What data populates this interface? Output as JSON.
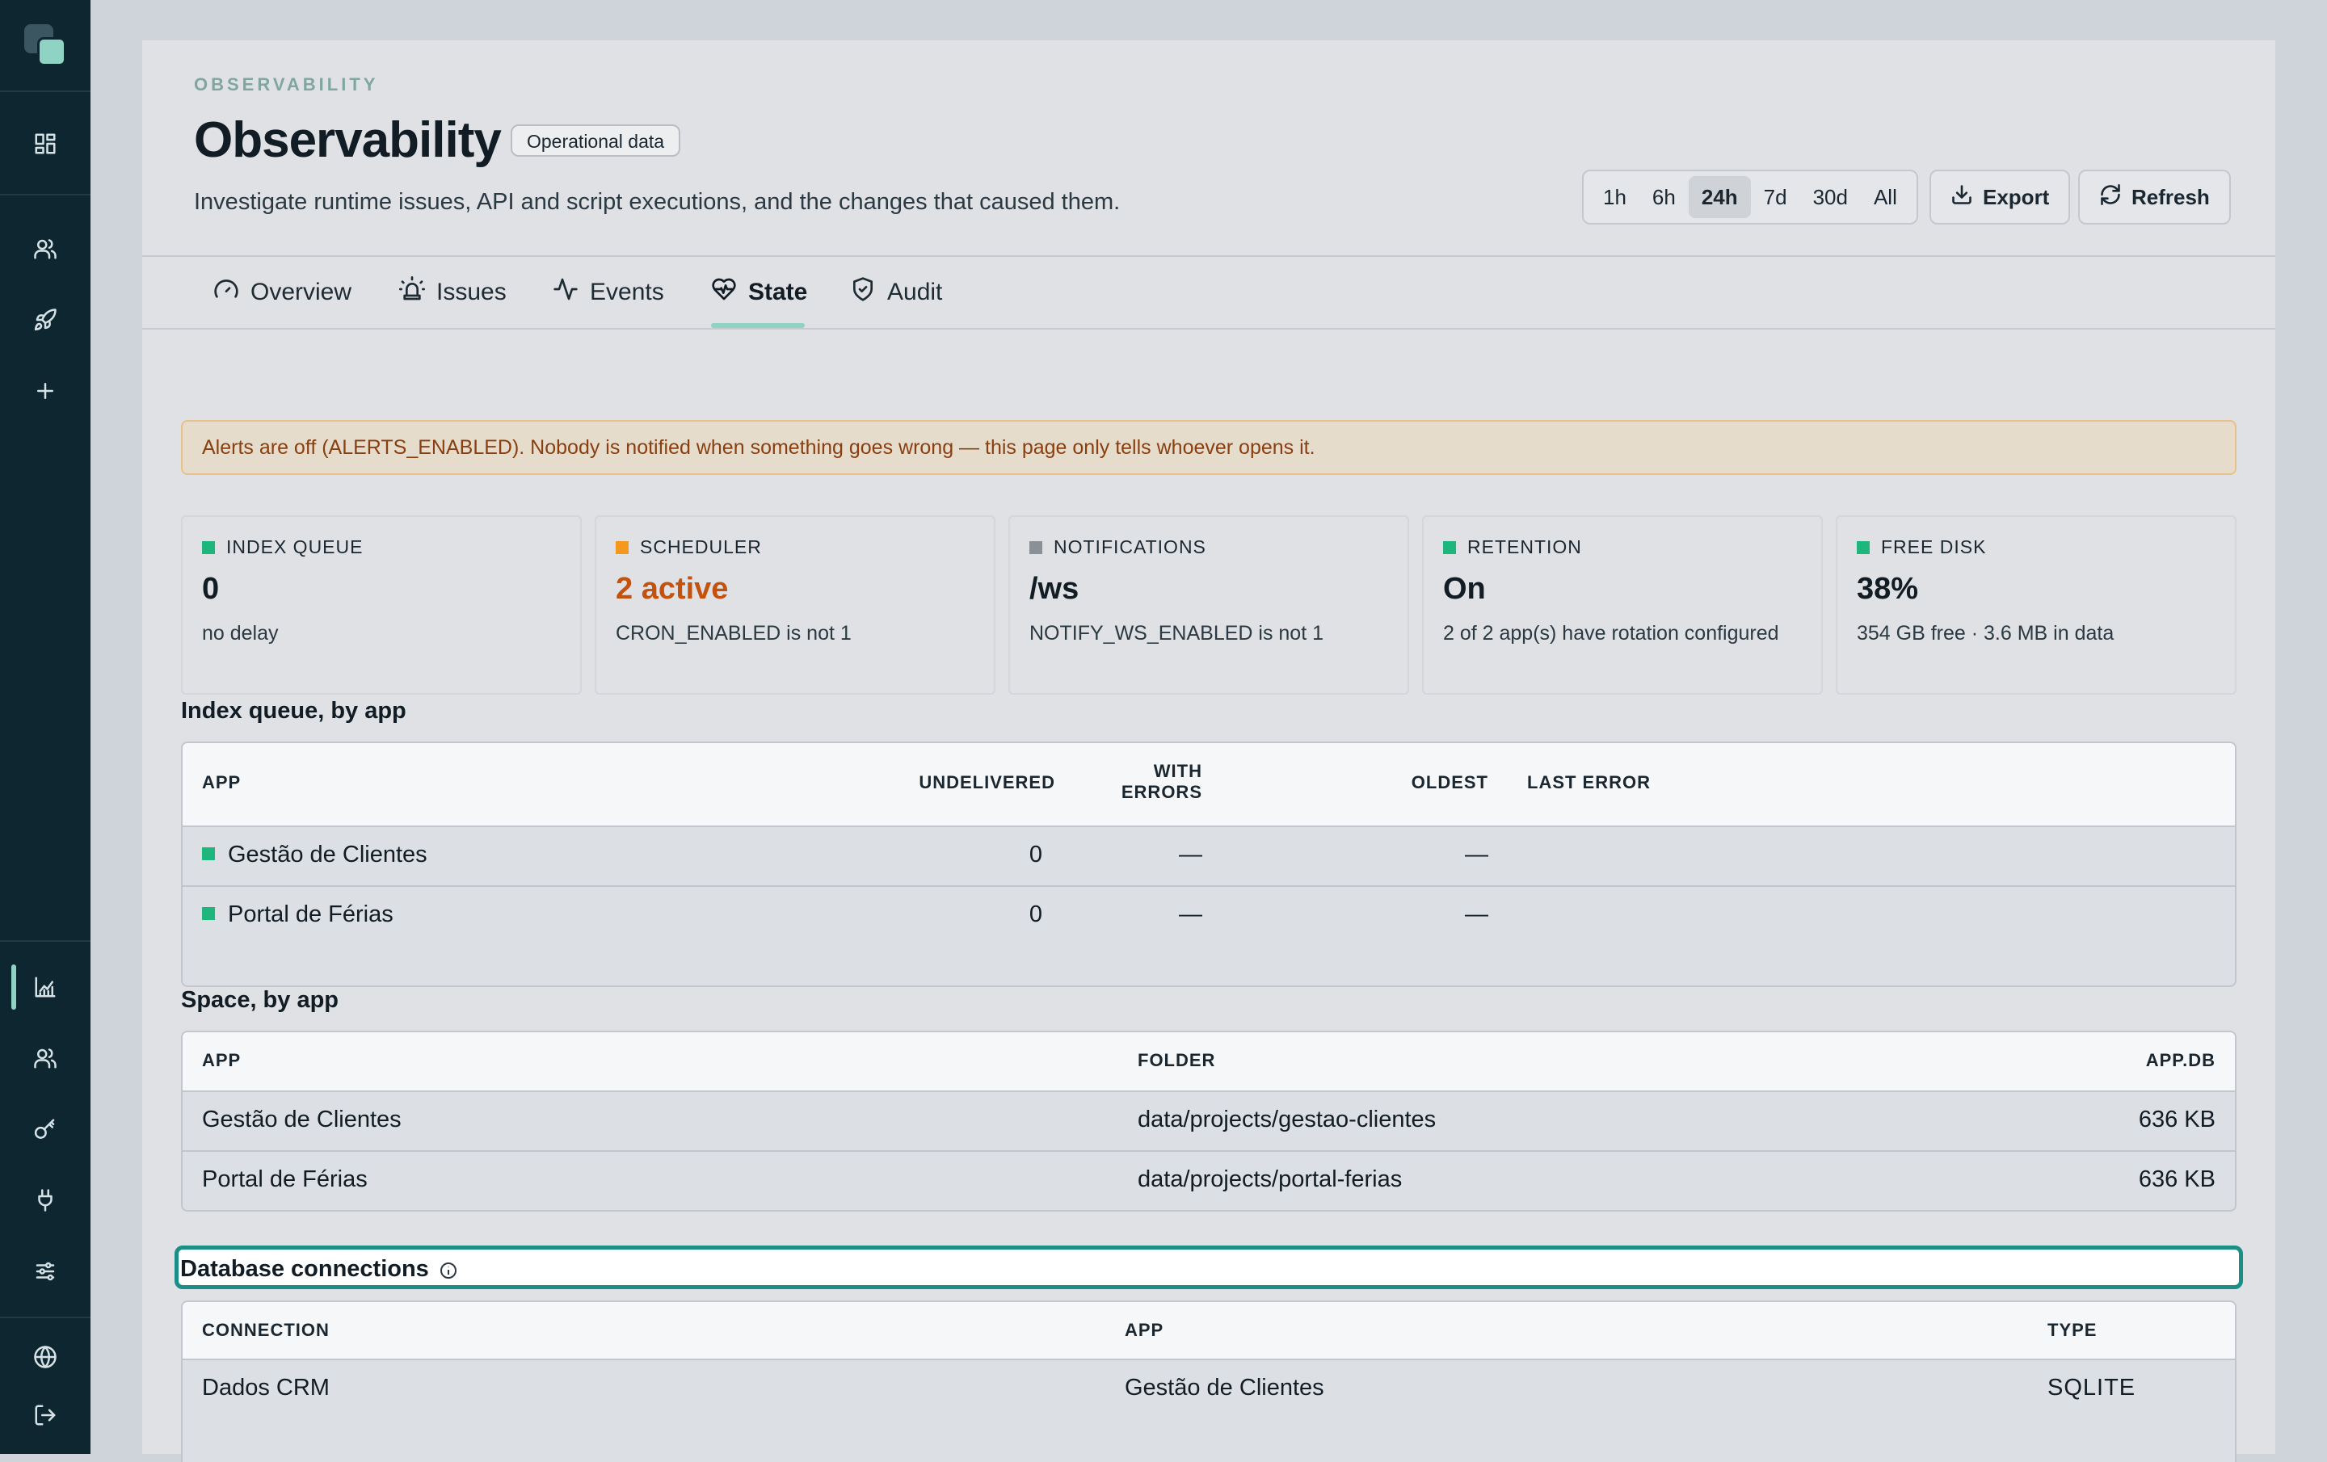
{
  "sidebar": {
    "icons": [
      "dashboard-icon",
      "users-icon",
      "rocket-icon",
      "plus-icon",
      "analytics-icon",
      "team-icon",
      "key-icon",
      "plug-icon",
      "sliders-icon",
      "globe-icon",
      "logout-icon"
    ],
    "active": "analytics-icon"
  },
  "header": {
    "eyebrow": "OBSERVABILITY",
    "title": "Observability",
    "badge": "Operational data",
    "subtitle": "Investigate runtime issues, API and script executions, and the changes that caused them."
  },
  "time_range": {
    "options": [
      "1h",
      "6h",
      "24h",
      "7d",
      "30d",
      "All"
    ],
    "selected": "24h"
  },
  "actions": {
    "export": "Export",
    "refresh": "Refresh"
  },
  "tabs": [
    {
      "label": "Overview",
      "icon": "gauge-icon"
    },
    {
      "label": "Issues",
      "icon": "siren-icon"
    },
    {
      "label": "Events",
      "icon": "activity-icon"
    },
    {
      "label": "State",
      "icon": "heart-pulse-icon"
    },
    {
      "label": "Audit",
      "icon": "shield-check-icon"
    }
  ],
  "active_tab": "State",
  "alert": "Alerts are off (ALERTS_ENABLED). Nobody is notified when something goes wrong — this page only tells whoever opens it.",
  "stats": [
    {
      "label": "INDEX QUEUE",
      "value": "0",
      "sub": "no delay",
      "color": "#1fb67d",
      "value_color": "#111c24"
    },
    {
      "label": "SCHEDULER",
      "value": "2 active",
      "sub": "CRON_ENABLED is not 1",
      "color": "#f39a1e",
      "value_color": "#c4520d"
    },
    {
      "label": "NOTIFICATIONS",
      "value": "/ws",
      "sub": "NOTIFY_WS_ENABLED is not 1",
      "color": "#8a9097",
      "value_color": "#111c24"
    },
    {
      "label": "RETENTION",
      "value": "On",
      "sub": "2 of 2 app(s) have rotation configured",
      "color": "#1fb67d",
      "value_color": "#111c24"
    },
    {
      "label": "FREE DISK",
      "value": "38%",
      "sub": "354 GB free · 3.6 MB in data",
      "color": "#1fb67d",
      "value_color": "#111c24"
    }
  ],
  "index_queue": {
    "title": "Index queue, by app",
    "headers": {
      "app": "APP",
      "undelivered": "UNDELIVERED",
      "with_errors_1": "WITH",
      "with_errors_2": "ERRORS",
      "oldest": "OLDEST",
      "last_error": "LAST ERROR"
    },
    "rows": [
      {
        "app": "Gestão de Clientes",
        "undelivered": "0",
        "with_errors": "—",
        "oldest": "—",
        "last_error": ""
      },
      {
        "app": "Portal de Férias",
        "undelivered": "0",
        "with_errors": "—",
        "oldest": "—",
        "last_error": ""
      }
    ]
  },
  "space": {
    "title": "Space, by app",
    "headers": {
      "app": "APP",
      "folder": "FOLDER",
      "appdb": "APP.DB"
    },
    "rows": [
      {
        "app": "Gestão de Clientes",
        "folder": "data/projects/gestao-clientes",
        "appdb": "636 KB"
      },
      {
        "app": "Portal de Férias",
        "folder": "data/projects/portal-ferias",
        "appdb": "636 KB"
      }
    ]
  },
  "db_connections": {
    "title": "Database connections",
    "headers": {
      "connection": "CONNECTION",
      "app": "APP",
      "type": "TYPE"
    },
    "rows": [
      {
        "connection": "Dados CRM",
        "app": "Gestão de Clientes",
        "type": "SQLITE"
      }
    ]
  }
}
